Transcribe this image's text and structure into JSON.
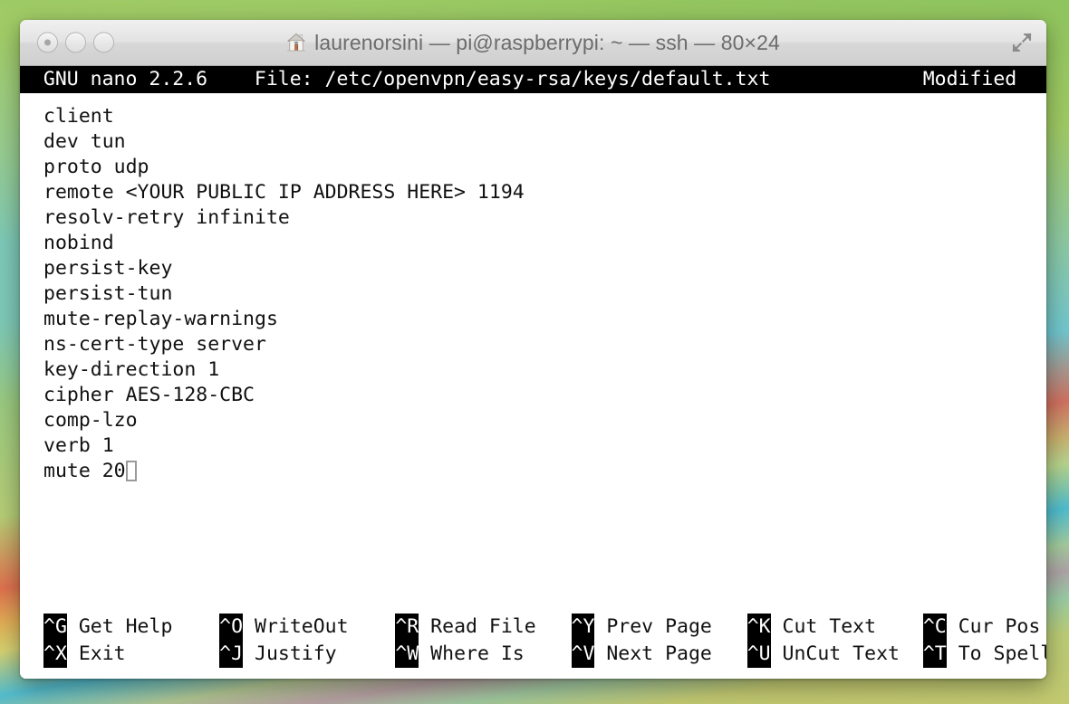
{
  "window": {
    "title": "laurenorsini — pi@raspberrypi: ~ — ssh — 80×24",
    "icon": "house-icon",
    "controls": {
      "close": "close-button",
      "minimize": "minimize-button",
      "zoom": "zoom-button",
      "fullscreen": "fullscreen-button"
    }
  },
  "nano": {
    "header": {
      "program": "GNU nano 2.2.6",
      "file_label": "File: /etc/openvpn/easy-rsa/keys/default.txt",
      "file_path": "/etc/openvpn/easy-rsa/keys/default.txt",
      "status": "Modified",
      "full_line": "  GNU nano 2.2.6    File: /etc/openvpn/easy-rsa/keys/default.txt             Modified  "
    },
    "lines": [
      "client",
      "dev tun",
      "proto udp",
      "remote <YOUR PUBLIC IP ADDRESS HERE> 1194",
      "resolv-retry infinite",
      "nobind",
      "persist-key",
      "persist-tun",
      "mute-replay-warnings",
      "ns-cert-type server",
      "key-direction 1",
      "cipher AES-128-CBC",
      "comp-lzo",
      "verb 1",
      "mute 20"
    ],
    "cursor": {
      "line": 15,
      "column": 8,
      "style": "hollow-block"
    },
    "shortcuts": [
      {
        "key": "^G",
        "label": "Get Help",
        "key2": "^X",
        "label2": "Exit"
      },
      {
        "key": "^O",
        "label": "WriteOut",
        "key2": "^J",
        "label2": "Justify"
      },
      {
        "key": "^R",
        "label": "Read File",
        "key2": "^W",
        "label2": "Where Is"
      },
      {
        "key": "^Y",
        "label": "Prev Page",
        "key2": "^V",
        "label2": "Next Page"
      },
      {
        "key": "^K",
        "label": "Cut Text",
        "key2": "^U",
        "label2": "UnCut Text"
      },
      {
        "key": "^C",
        "label": "Cur Pos",
        "key2": "^T",
        "label2": "To Spell"
      }
    ]
  },
  "colors": {
    "terminal_bg": "#ffffff",
    "terminal_fg": "#000000",
    "inverse_bg": "#000000",
    "inverse_fg": "#ffffff",
    "title_text": "#6c6c6c",
    "cursor": "#9a9a9a",
    "desktop_green": "#9dc967"
  }
}
